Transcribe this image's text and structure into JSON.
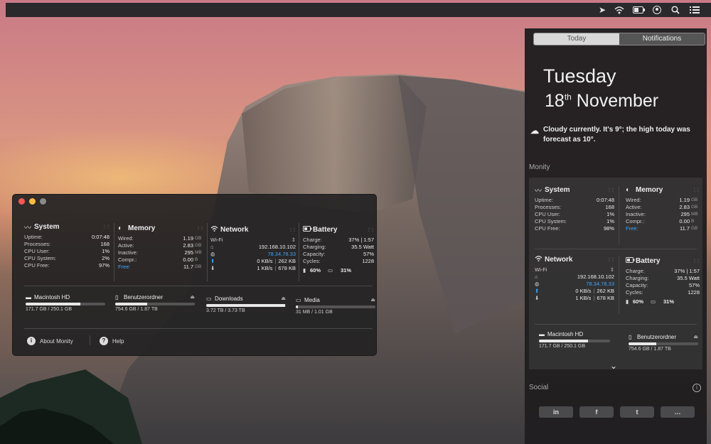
{
  "menubar": {
    "icons": [
      "location-arrow-icon",
      "wifi-icon",
      "battery-icon",
      "user-icon",
      "search-icon",
      "notification-center-icon"
    ]
  },
  "monity": {
    "system": {
      "title": "System",
      "rows": [
        {
          "k": "Uptime:",
          "v": "0:07:48"
        },
        {
          "k": "Processes:",
          "v": "168"
        },
        {
          "k": "CPU User:",
          "v": "1%"
        },
        {
          "k": "CPU System:",
          "v": "2%"
        },
        {
          "k": "CPU Free:",
          "v": "97%"
        }
      ]
    },
    "memory": {
      "title": "Memory",
      "rows": [
        {
          "k": "Wired:",
          "v": "1.19",
          "u": "GB"
        },
        {
          "k": "Active:",
          "v": "2.83",
          "u": "GB"
        },
        {
          "k": "Inactive:",
          "v": "295",
          "u": "MB"
        },
        {
          "k": "Compr.:",
          "v": "0.00",
          "u": "B"
        },
        {
          "k": "Free:",
          "v": "11.7",
          "u": "GB"
        }
      ]
    },
    "network": {
      "title": "Network",
      "wifi_label": "Wi-Fi",
      "local_ip": "192.168.10.102",
      "public_ip": "78.34.78.33",
      "up_rate": "0 KB/s",
      "up_total": "262 KB",
      "down_rate": "1 KB/s",
      "down_total": "678 KB"
    },
    "battery": {
      "title": "Battery",
      "rows": [
        {
          "k": "Charge:",
          "v": "37% | 1:57"
        },
        {
          "k": "Charging:",
          "v": "35.5 Watt"
        },
        {
          "k": "Capacity:",
          "v": "57%"
        },
        {
          "k": "Cycles:",
          "v": "1228"
        }
      ],
      "battery_pct": "60%",
      "cpu_pct": "31%"
    },
    "disks": [
      {
        "name": "Macintosh HD",
        "size": "171.7 GB / 250.1 GB",
        "fill": 0.69
      },
      {
        "name": "Benutzerordner",
        "size": "754.6 GB / 1.87 TB",
        "fill": 0.4
      },
      {
        "name": "Downloads",
        "size": "3.72 TB / 3.73 TB",
        "fill": 0.99
      },
      {
        "name": "Media",
        "size": "31 MB / 1.01 GB",
        "fill": 0.03
      }
    ],
    "footer": {
      "about": "About Monity",
      "help": "Help"
    }
  },
  "notification_center": {
    "tabs": {
      "today": "Today",
      "notifications": "Notifications"
    },
    "day": "Tuesday",
    "date_num": "18",
    "date_suffix": "th",
    "date_month": "November",
    "weather": "Cloudy currently. It's 9°; the high today was forecast as 10°.",
    "monity_section": "Monity",
    "system": {
      "title": "System",
      "rows": [
        {
          "k": "Uptime:",
          "v": "0:07:48"
        },
        {
          "k": "Processes:",
          "v": "168"
        },
        {
          "k": "CPU User:",
          "v": "1%"
        },
        {
          "k": "CPU System:",
          "v": "1%"
        },
        {
          "k": "CPU Free:",
          "v": "98%"
        }
      ]
    },
    "memory": {
      "title": "Memory",
      "rows": [
        {
          "k": "Wired:",
          "v": "1.19",
          "u": "GB"
        },
        {
          "k": "Active:",
          "v": "2.83",
          "u": "GB"
        },
        {
          "k": "Inactive:",
          "v": "295",
          "u": "MB"
        },
        {
          "k": "Compr.:",
          "v": "0.00",
          "u": "B"
        },
        {
          "k": "Free:",
          "v": "11.7",
          "u": "GB"
        }
      ]
    },
    "network": {
      "title": "Network",
      "wifi_label": "Wi-Fi",
      "local_ip": "192.168.10.102",
      "public_ip": "78.34.78.33",
      "up_rate": "0 KB/s",
      "up_total": "262 KB",
      "down_rate": "1 KB/s",
      "down_total": "678 KB"
    },
    "battery": {
      "title": "Battery",
      "rows": [
        {
          "k": "Charge:",
          "v": "37% | 1:57"
        },
        {
          "k": "Charging:",
          "v": "35.5 Watt"
        },
        {
          "k": "Capacity:",
          "v": "57%"
        },
        {
          "k": "Cycles:",
          "v": "1228"
        }
      ],
      "battery_pct": "60%",
      "cpu_pct": "31%"
    },
    "disks": [
      {
        "name": "Macintosh HD",
        "size": "171.7 GB / 250.1 GB",
        "fill": 0.69
      },
      {
        "name": "Benutzerordner",
        "size": "754.6 GB / 1.87 TB",
        "fill": 0.4
      }
    ],
    "social_section": "Social",
    "social_buttons": [
      "in",
      "f",
      "t",
      "…"
    ]
  },
  "colors": {
    "accent_blue": "#3aa6ff"
  }
}
